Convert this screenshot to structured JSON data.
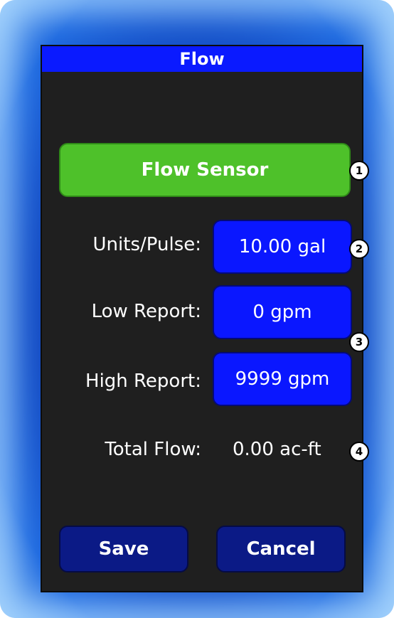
{
  "title": "Flow",
  "sensor_button": "Flow Sensor",
  "fields": {
    "units_pulse": {
      "label": "Units/Pulse:",
      "value": "10.00 gal"
    },
    "low_report": {
      "label": "Low Report:",
      "value": "0 gpm"
    },
    "high_report": {
      "label": "High Report:",
      "value": "9999 gpm"
    },
    "total_flow": {
      "label": "Total Flow:",
      "value": "0.00 ac-ft"
    }
  },
  "buttons": {
    "save": "Save",
    "cancel": "Cancel"
  },
  "callouts": [
    "1",
    "2",
    "3",
    "4"
  ],
  "colors": {
    "title_bar": "#0a1aff",
    "sensor_button": "#4ec12a",
    "value_button": "#0a17ff",
    "footer_button": "#0b1a86",
    "screen_bg": "#1f1f1f"
  }
}
